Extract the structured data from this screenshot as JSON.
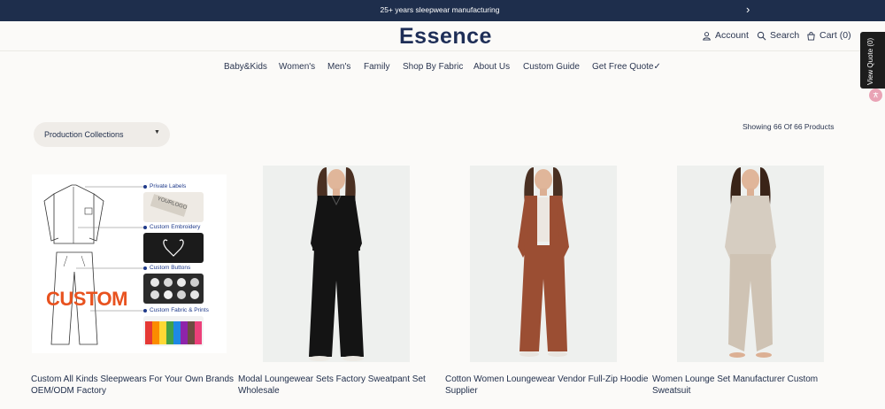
{
  "announcement": {
    "text": "25+ years sleepwear manufacturing",
    "chevron": "›"
  },
  "header": {
    "logo": "Essence",
    "account": "Account",
    "search": "Search",
    "cart": "Cart (0)"
  },
  "nav": [
    "Baby&Kids",
    "Women's",
    "Men's",
    "Family",
    "Shop By Fabric",
    "About Us",
    "Custom Guide",
    "Get Free Quote✓"
  ],
  "side": {
    "view_quote": "View Quote (0)"
  },
  "filter": {
    "label": "Production Collections",
    "caret": "▼"
  },
  "results": "Showing 66 Of 66 Products",
  "custom_image": {
    "labels": [
      "Private Labels",
      "Custom Embroidery",
      "Custom Buttons",
      "Custom Fabric & Prints"
    ],
    "big_text": "CUSTOM",
    "logo_text": "YOURLOGO"
  },
  "products": [
    {
      "title": "Custom All Kinds Sleepwears For Your Own Brands OEM/ODM Factory"
    },
    {
      "title": "Modal Loungewear Sets Factory Sweatpant Set Wholesale",
      "color": "#141414"
    },
    {
      "title": "Cotton Women Loungewear Vendor Full-Zip Hoodie Supplier",
      "color": "#9b4e33"
    },
    {
      "title": "Women Lounge Set Manufacturer Custom Sweatsuit",
      "color": "#cfc3b4"
    }
  ],
  "colors": {
    "navy": "#1e2e4c",
    "logo": "#1e2e57",
    "background": "#fbfaf8"
  }
}
